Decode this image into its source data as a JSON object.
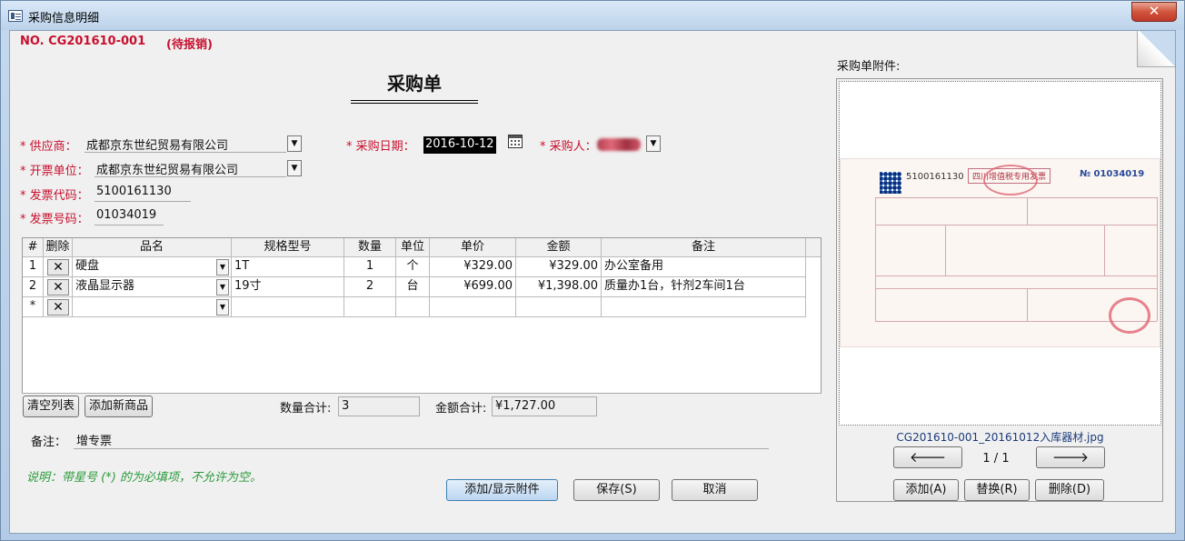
{
  "window": {
    "title": "采购信息明细",
    "close_label": "✕"
  },
  "header": {
    "po_number": "NO.  CG201610-001",
    "status": "(待报销)",
    "form_title": "采购单"
  },
  "fields": {
    "supplier_label": "* 供应商：",
    "supplier_value": "成都京东世纪贸易有限公司",
    "invoice_unit_label": "* 开票单位：",
    "invoice_unit_value": "成都京东世纪贸易有限公司",
    "invoice_code_label": "* 发票代码：",
    "invoice_code_value": "5100161130",
    "invoice_number_label": "* 发票号码：",
    "invoice_number_value": "01034019",
    "purchase_date_label": "* 采购日期：",
    "purchase_date_value": "2016-10-12",
    "purchaser_label": "* 采购人："
  },
  "grid": {
    "columns": [
      "#",
      "删除",
      "品名",
      "规格型号",
      "数量",
      "单位",
      "单价",
      "金额",
      "备注"
    ],
    "rows": [
      {
        "no": "1",
        "name": "硬盘",
        "spec": "1T",
        "qty": "1",
        "unit": "个",
        "price": "¥329.00",
        "amount": "¥329.00",
        "remark": "办公室备用"
      },
      {
        "no": "2",
        "name": "液晶显示器",
        "spec": "19寸",
        "qty": "2",
        "unit": "台",
        "price": "¥699.00",
        "amount": "¥1,398.00",
        "remark": "质量办1台，针剂2车间1台"
      }
    ],
    "new_row_marker": "*",
    "delete_glyph": "✕",
    "clear_button": "清空列表",
    "add_item_button": "添加新商品",
    "qty_total_label": "数量合计:",
    "qty_total_value": "3",
    "amount_total_label": "金额合计:",
    "amount_total_value": "¥1,727.00"
  },
  "remark": {
    "label": "备注：",
    "value": "增专票"
  },
  "note": "说明：带星号 (*) 的为必填项，不允许为空。",
  "actions": {
    "attach_button": "添加/显示附件",
    "save_button": "保存(S)",
    "cancel_button": "取消"
  },
  "attachment": {
    "label": "采购单附件:",
    "filename": "CG201610-001_20161012入库器材.jpg",
    "pager": "1 / 1",
    "prev_glyph": "🡐",
    "next_glyph": "🡒",
    "add_button": "添加(A)",
    "replace_button": "替换(R)",
    "delete_button": "删除(D)",
    "invoice_code": "5100161130",
    "invoice_title": "四川增值税专用发票",
    "invoice_no_prefix": "№",
    "invoice_no": "01034019"
  },
  "colors": {
    "required_red": "#c8102e",
    "note_green": "#2a9a3a",
    "accent_blue": "#3c7fb1"
  }
}
